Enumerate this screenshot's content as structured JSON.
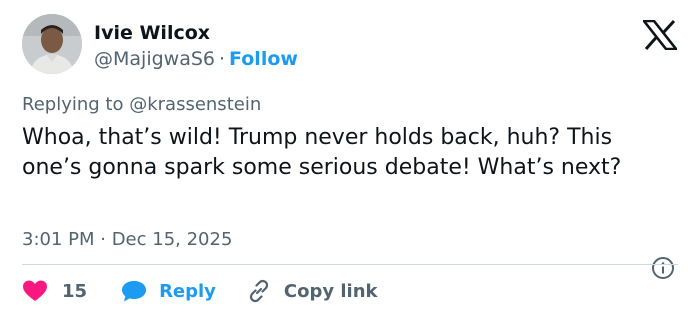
{
  "author": {
    "name": "Ivie Wilcox",
    "handle": "@MajigwaS6",
    "separator": "·",
    "follow_label": "Follow"
  },
  "logo": "x-logo-icon",
  "reply_context": {
    "prefix": "Replying to",
    "mention": "@krassenstein"
  },
  "tweet": {
    "text": "Whoa, that’s wild! Trump never holds back, huh? This one’s gonna spark some serious debate! What’s next?",
    "timestamp": "3:01 PM · Dec 15, 2025"
  },
  "actions": {
    "like_count": "15",
    "reply_label": "Reply",
    "copy_link_label": "Copy link"
  },
  "colors": {
    "accent": "#1d9bf0",
    "heart": "#f91880",
    "muted_text": "#536471",
    "primary_text": "#0f1419",
    "divider": "#cfd9de"
  },
  "icons": [
    "avatar",
    "x-logo-icon",
    "info-icon",
    "heart-icon",
    "reply-bubble-icon",
    "link-icon"
  ]
}
